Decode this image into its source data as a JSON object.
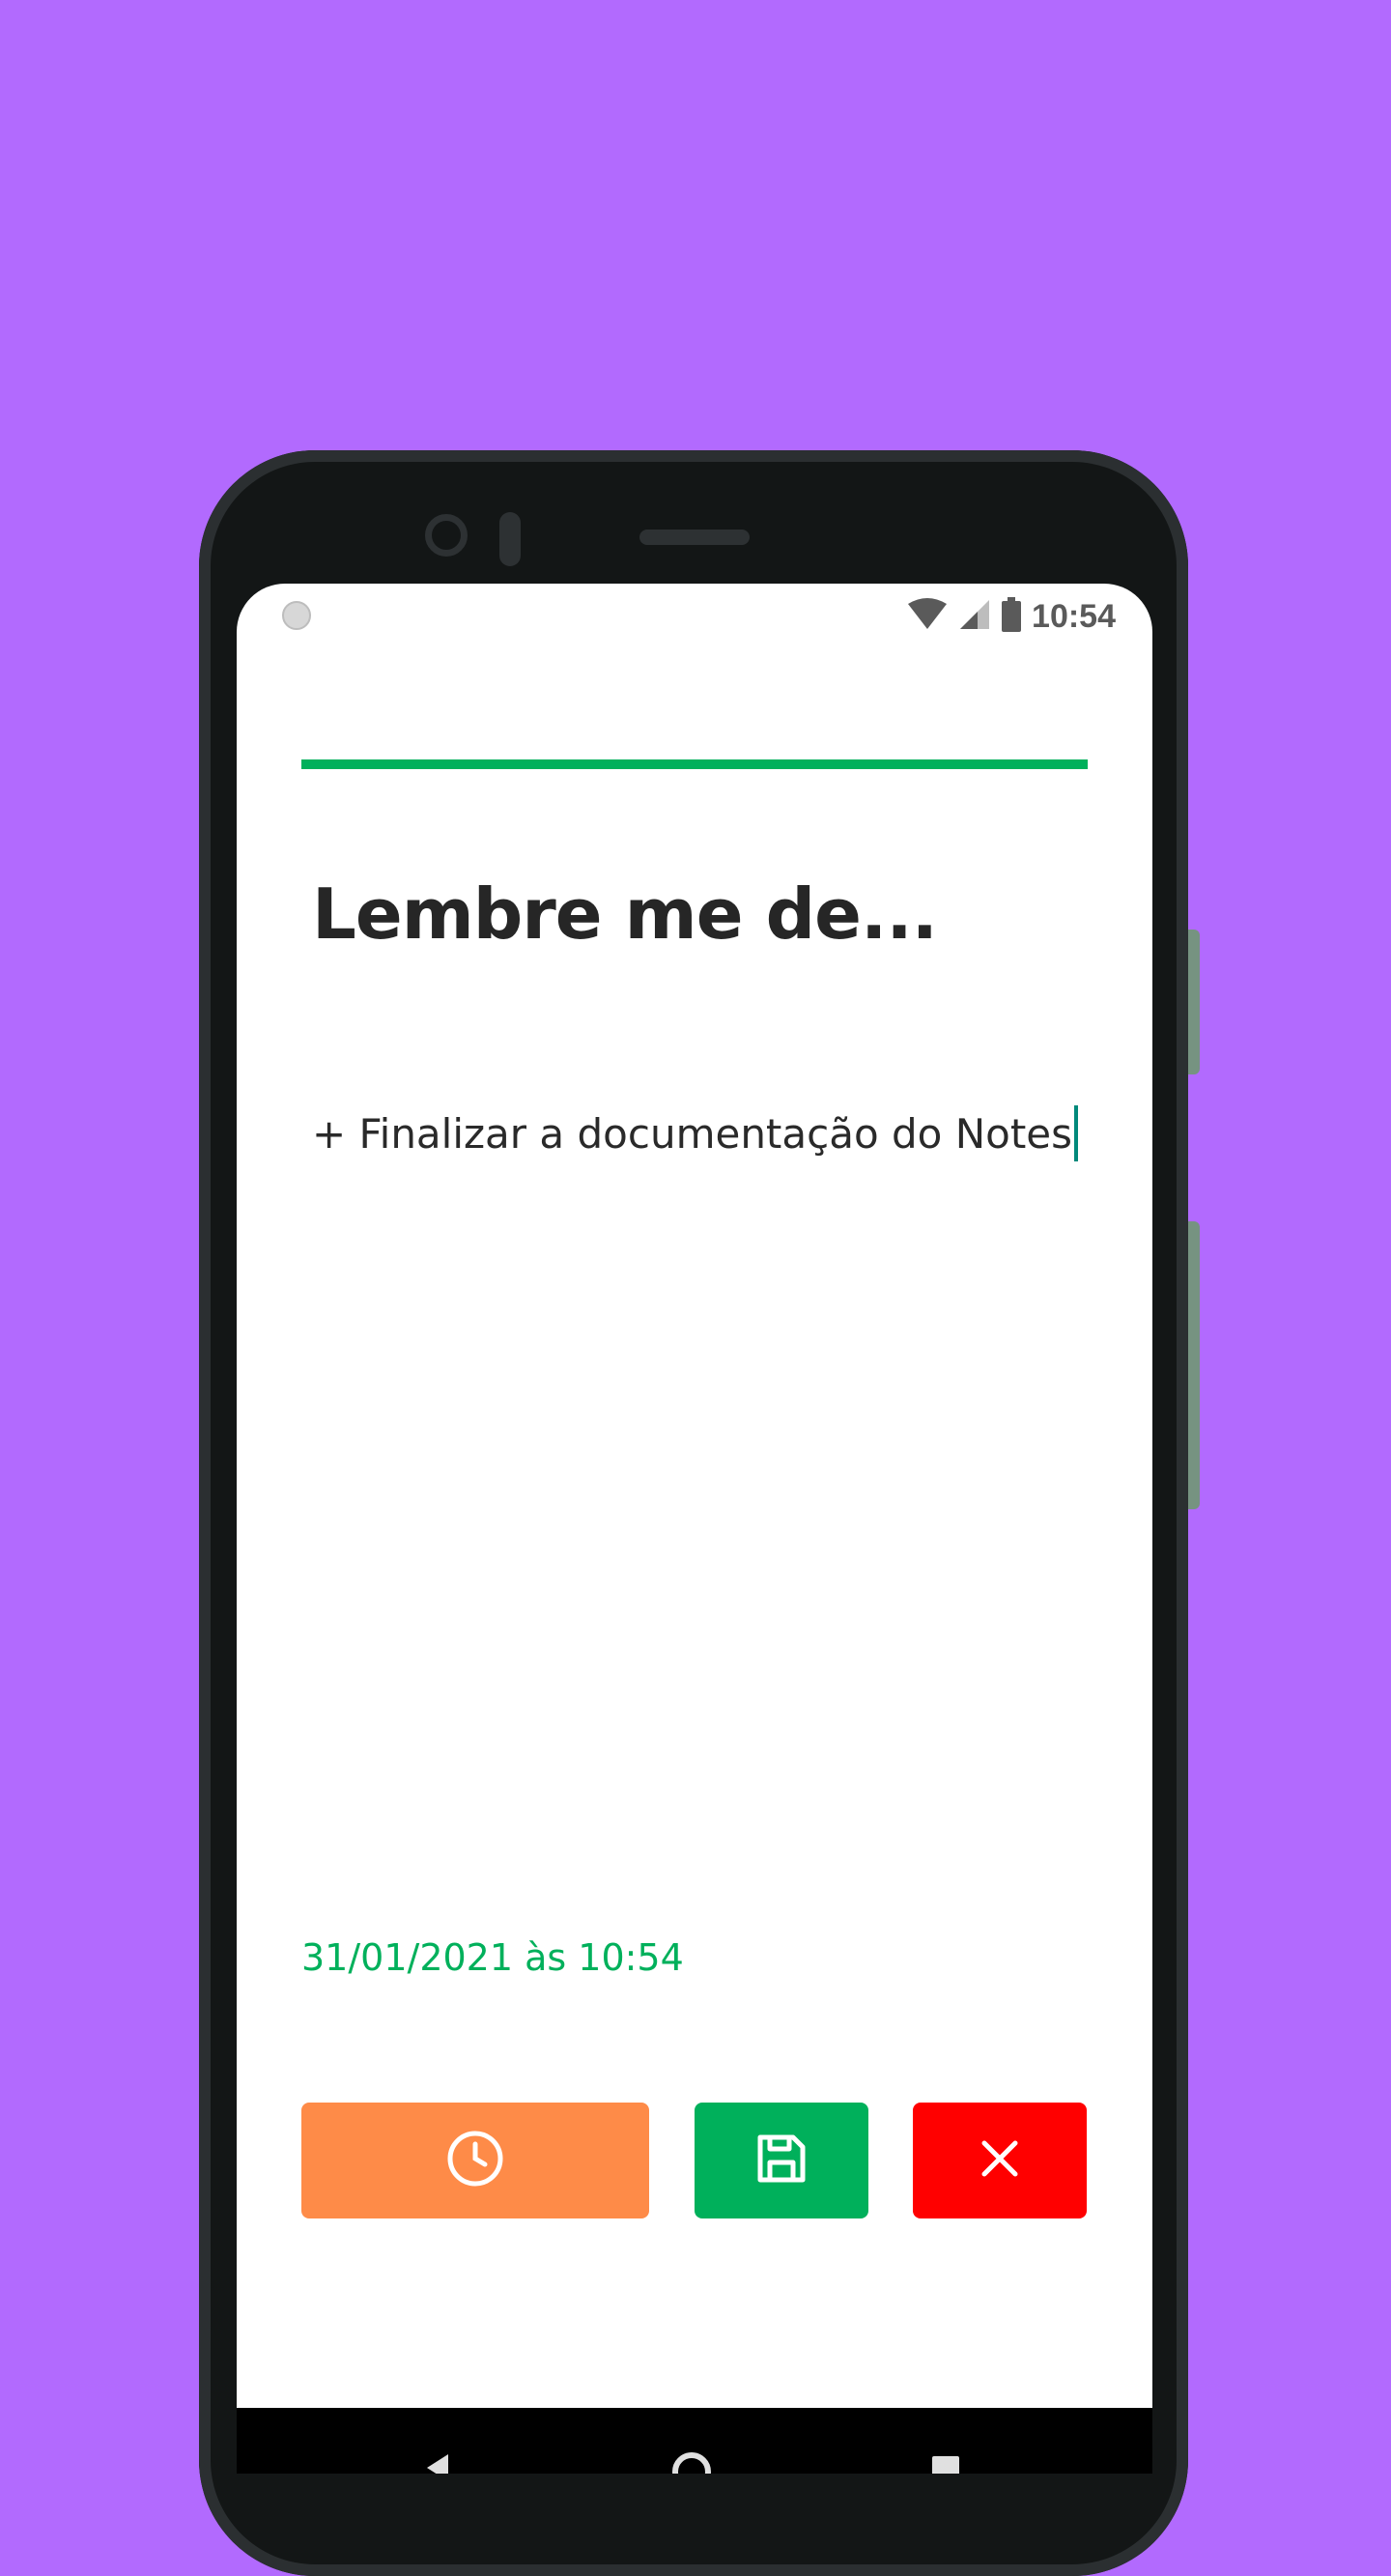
{
  "status_bar": {
    "time": "10:54",
    "icons": [
      "wifi-icon",
      "signal-icon",
      "battery-icon"
    ]
  },
  "note": {
    "title": "Lembre me de...",
    "body": "+ Finalizar a documentação do Notes",
    "timestamp": "31/01/2021 às 10:54"
  },
  "actions": {
    "reminder_icon": "clock-icon",
    "save_icon": "floppy-disk-icon",
    "delete_icon": "close-icon"
  },
  "navigation": {
    "buttons": [
      "back-icon",
      "home-icon",
      "recents-icon"
    ]
  },
  "colors": {
    "background": "#b26afe",
    "accent_green": "#00b05b",
    "reminder_orange": "#fe8b48",
    "delete_red": "#ff0000"
  }
}
